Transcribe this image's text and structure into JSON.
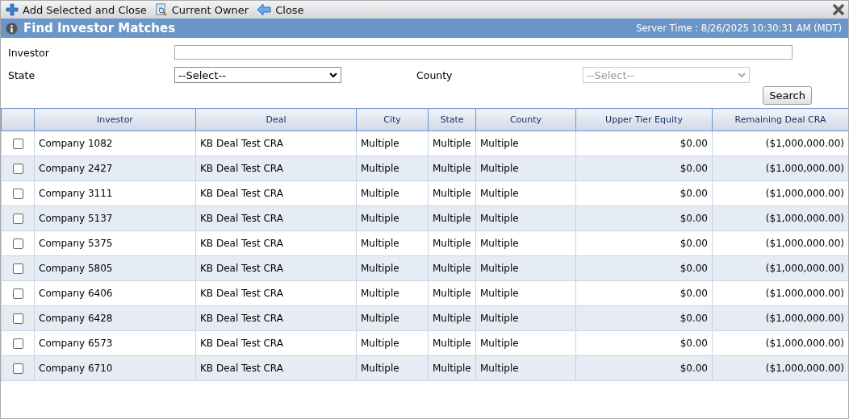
{
  "toolbar": [
    {
      "kind": "add",
      "label": "Add Selected and Close"
    },
    {
      "kind": "owner",
      "label": "Current Owner"
    },
    {
      "kind": "back",
      "label": "Close"
    }
  ],
  "title": "Find Investor Matches",
  "server_time": "Server Time : 8/26/2025 10:30:31 AM (MDT)",
  "form": {
    "investor": {
      "label": "Investor"
    },
    "state": {
      "label": "State",
      "value": "--Select--",
      "disabled": false
    },
    "county": {
      "label": "County",
      "value": "--Select--",
      "disabled": true
    },
    "search_button": "Search"
  },
  "table": {
    "columns": [
      "Investor",
      "Deal",
      "City",
      "State",
      "County",
      "Upper Tier Equity",
      "Remaining Deal CRA"
    ],
    "rows": [
      {
        "checked": false,
        "cells": [
          "Company 1082",
          "KB Deal Test CRA",
          "Multiple",
          "Multiple",
          "Multiple",
          "$0.00",
          "($1,000,000.00)"
        ]
      },
      {
        "checked": false,
        "cells": [
          "Company 2427",
          "KB Deal Test CRA",
          "Multiple",
          "Multiple",
          "Multiple",
          "$0.00",
          "($1,000,000.00)"
        ]
      },
      {
        "checked": false,
        "cells": [
          "Company 3111",
          "KB Deal Test CRA",
          "Multiple",
          "Multiple",
          "Multiple",
          "$0.00",
          "($1,000,000.00)"
        ]
      },
      {
        "checked": false,
        "cells": [
          "Company 5137",
          "KB Deal Test CRA",
          "Multiple",
          "Multiple",
          "Multiple",
          "$0.00",
          "($1,000,000.00)"
        ]
      },
      {
        "checked": false,
        "cells": [
          "Company 5375",
          "KB Deal Test CRA",
          "Multiple",
          "Multiple",
          "Multiple",
          "$0.00",
          "($1,000,000.00)"
        ]
      },
      {
        "checked": false,
        "cells": [
          "Company 5805",
          "KB Deal Test CRA",
          "Multiple",
          "Multiple",
          "Multiple",
          "$0.00",
          "($1,000,000.00)"
        ]
      },
      {
        "checked": false,
        "cells": [
          "Company 6406",
          "KB Deal Test CRA",
          "Multiple",
          "Multiple",
          "Multiple",
          "$0.00",
          "($1,000,000.00)"
        ]
      },
      {
        "checked": false,
        "cells": [
          "Company 6428",
          "KB Deal Test CRA",
          "Multiple",
          "Multiple",
          "Multiple",
          "$0.00",
          "($1,000,000.00)"
        ]
      },
      {
        "checked": false,
        "cells": [
          "Company 6573",
          "KB Deal Test CRA",
          "Multiple",
          "Multiple",
          "Multiple",
          "$0.00",
          "($1,000,000.00)"
        ]
      },
      {
        "checked": false,
        "cells": [
          "Company 6710",
          "KB Deal Test CRA",
          "Multiple",
          "Multiple",
          "Multiple",
          "$0.00",
          "($1,000,000.00)"
        ]
      }
    ]
  }
}
